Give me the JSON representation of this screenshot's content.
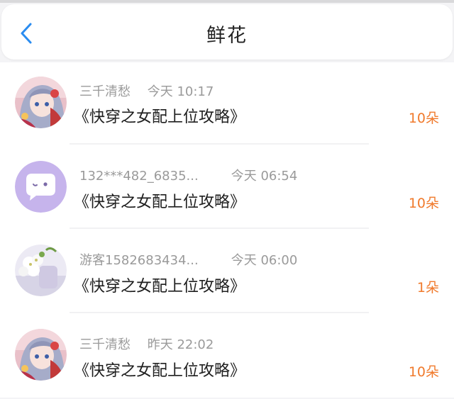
{
  "header": {
    "title": "鲜花",
    "back_icon": "chevron-left-icon",
    "accent_color": "#2a8cf0"
  },
  "gifts": [
    {
      "user": "三千清愁",
      "time": "今天 10:17",
      "book": "《快穿之女配上位攻略》",
      "count": "10朵",
      "avatar": "anime-girl-avatar"
    },
    {
      "user": "132***482_6835...",
      "time": "今天 06:54",
      "book": "《快穿之女配上位攻略》",
      "count": "10朵",
      "avatar": "chat-bubble-avatar"
    },
    {
      "user": "游客1582683434...",
      "time": "今天 06:00",
      "book": "《快穿之女配上位攻略》",
      "count": "1朵",
      "avatar": "flower-avatar"
    },
    {
      "user": "三千清愁",
      "time": "昨天 22:02",
      "book": "《快穿之女配上位攻略》",
      "count": "10朵",
      "avatar": "anime-girl-avatar"
    }
  ],
  "colors": {
    "count": "#f07a2c",
    "meta": "#9a9a9a",
    "title": "#222222"
  }
}
